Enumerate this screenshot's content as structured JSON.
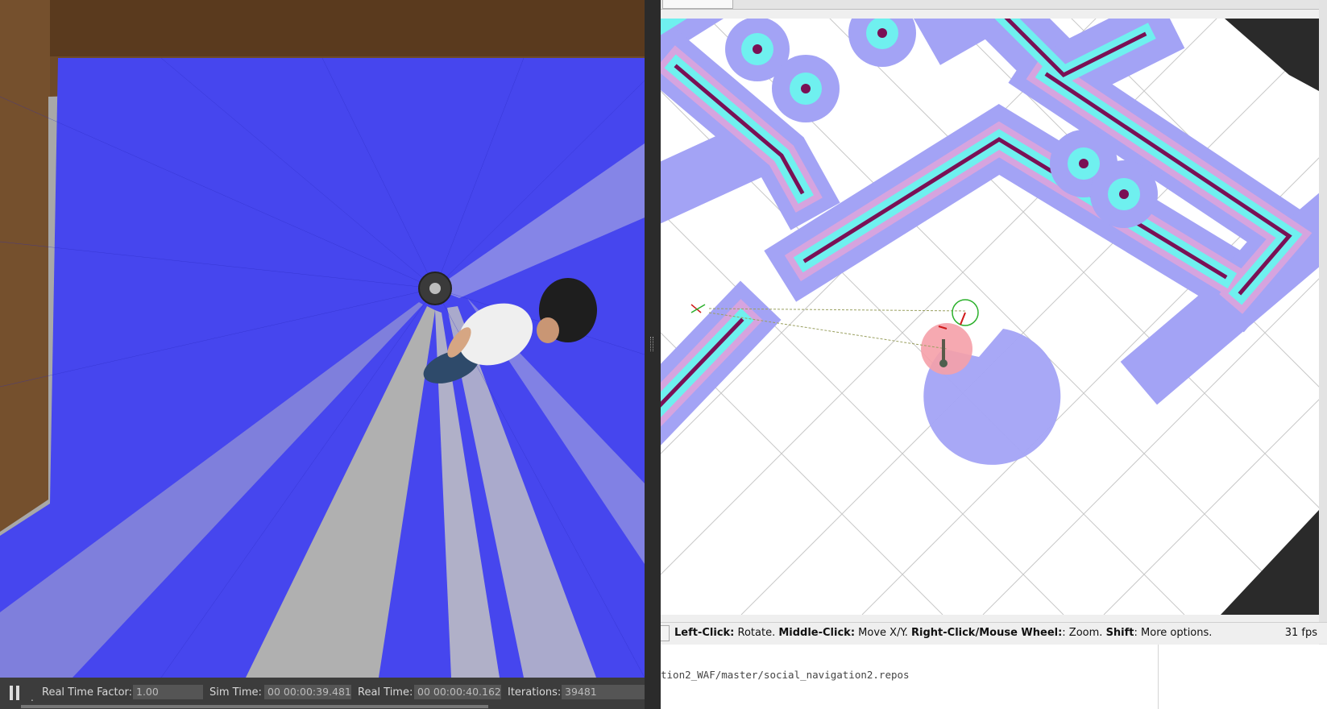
{
  "gazebo": {
    "real_time_factor_label": "Real Time Factor:",
    "real_time_factor": "1.00",
    "sim_time_label": "Sim Time:",
    "sim_time": "00 00:00:39.481",
    "real_time_label": "Real Time:",
    "real_time": "00 00:00:40.162",
    "iterations_label": "Iterations:",
    "iterations": "39481",
    "colors": {
      "laser": "#3f3ff0",
      "floor": "#a9a9a9",
      "wall": "#7a5430"
    }
  },
  "rviz": {
    "status": {
      "left_click": "Left-Click:",
      "left_click_action": " Rotate. ",
      "middle_click": "Middle-Click:",
      "middle_click_action": " Move X/Y. ",
      "right_click": "Right-Click/Mouse Wheel:",
      "right_click_action": ": Zoom. ",
      "shift": "Shift",
      "shift_action": ": More options."
    },
    "fps": "31 fps",
    "colors": {
      "inflation": "#a3a3f5",
      "lethal": "#6ff0ef",
      "obstacle": "#7a1055",
      "person_zone": "#f5a0a8"
    }
  },
  "terminal": {
    "line": "tion2_WAF/master/social_navigation2.repos"
  }
}
